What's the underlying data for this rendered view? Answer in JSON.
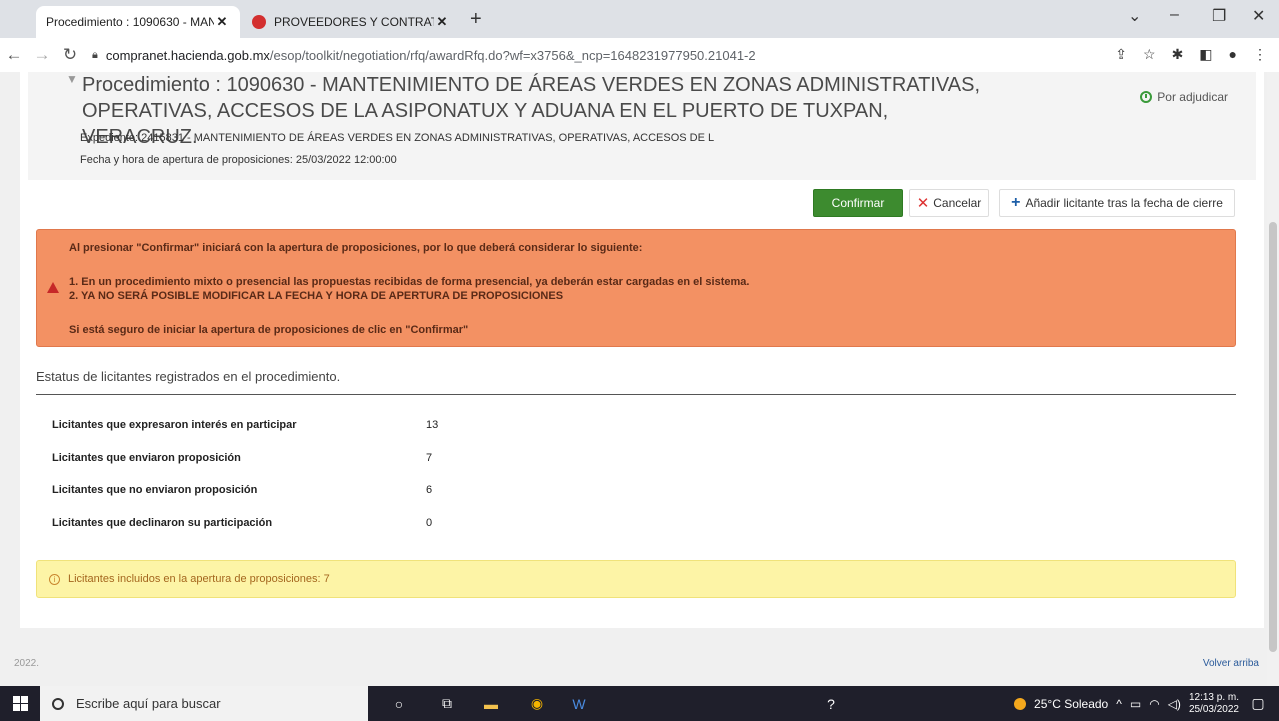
{
  "browser": {
    "tab_active": "Procedimiento : 1090630 - MAN",
    "tab_inactive": "PROVEEDORES Y CONTRATISTAS",
    "url_host": "compranet.hacienda.gob.mx",
    "url_path": "/esop/toolkit/negotiation/rfq/awardRfq.do?wf=x3756&_ncp=1648231977950.21041-2"
  },
  "header": {
    "title": "Procedimiento : 1090630 - MANTENIMIENTO DE ÁREAS VERDES EN ZONAS ADMINISTRATIVAS, OPERATIVAS, ACCESOS DE LA ASIPONATUX Y ADUANA EN EL PUERTO DE TUXPAN, VERACRUZ.",
    "status": "Por adjudicar",
    "expediente": "Expediente: 2415831 - MANTENIMIENTO DE ÁREAS VERDES EN ZONAS ADMINISTRATIVAS, OPERATIVAS, ACCESOS DE L",
    "fecha": "Fecha y hora de apertura de proposiciones: 25/03/2022 12:00:00"
  },
  "actions": {
    "confirm": "Confirmar",
    "cancel": "Cancelar",
    "add": "Añadir licitante tras la fecha de cierre"
  },
  "alert": {
    "line1": "Al presionar \"Confirmar\" iniciará con la apertura de proposiciones, por lo que deberá considerar lo siguiente:",
    "line2": "1. En un procedimiento mixto o presencial las propuestas recibidas de forma presencial, ya deberán estar cargadas en el sistema.",
    "line3": "2. YA NO SERÁ POSIBLE MODIFICAR LA FECHA Y HORA DE APERTURA DE PROPOSICIONES",
    "line4": "Si está seguro de iniciar la apertura de proposiciones de clic en \"Confirmar\""
  },
  "section_title": "Estatus de licitantes registrados en el procedimiento.",
  "stats": [
    {
      "label": "Licitantes que expresaron interés en participar",
      "value": "13"
    },
    {
      "label": "Licitantes que enviaron proposición",
      "value": "7"
    },
    {
      "label": "Licitantes que no enviaron proposición",
      "value": "6"
    },
    {
      "label": "Licitantes que declinaron su participación",
      "value": "0"
    }
  ],
  "info": "Licitantes incluidos en la apertura de proposiciones: 7",
  "footer": {
    "year": "2022.",
    "back_top": "Volver arriba"
  },
  "taskbar": {
    "search_placeholder": "Escribe aquí para buscar",
    "weather": "25°C  Soleado",
    "time": "12:13 p. m.",
    "date": "25/03/2022"
  }
}
